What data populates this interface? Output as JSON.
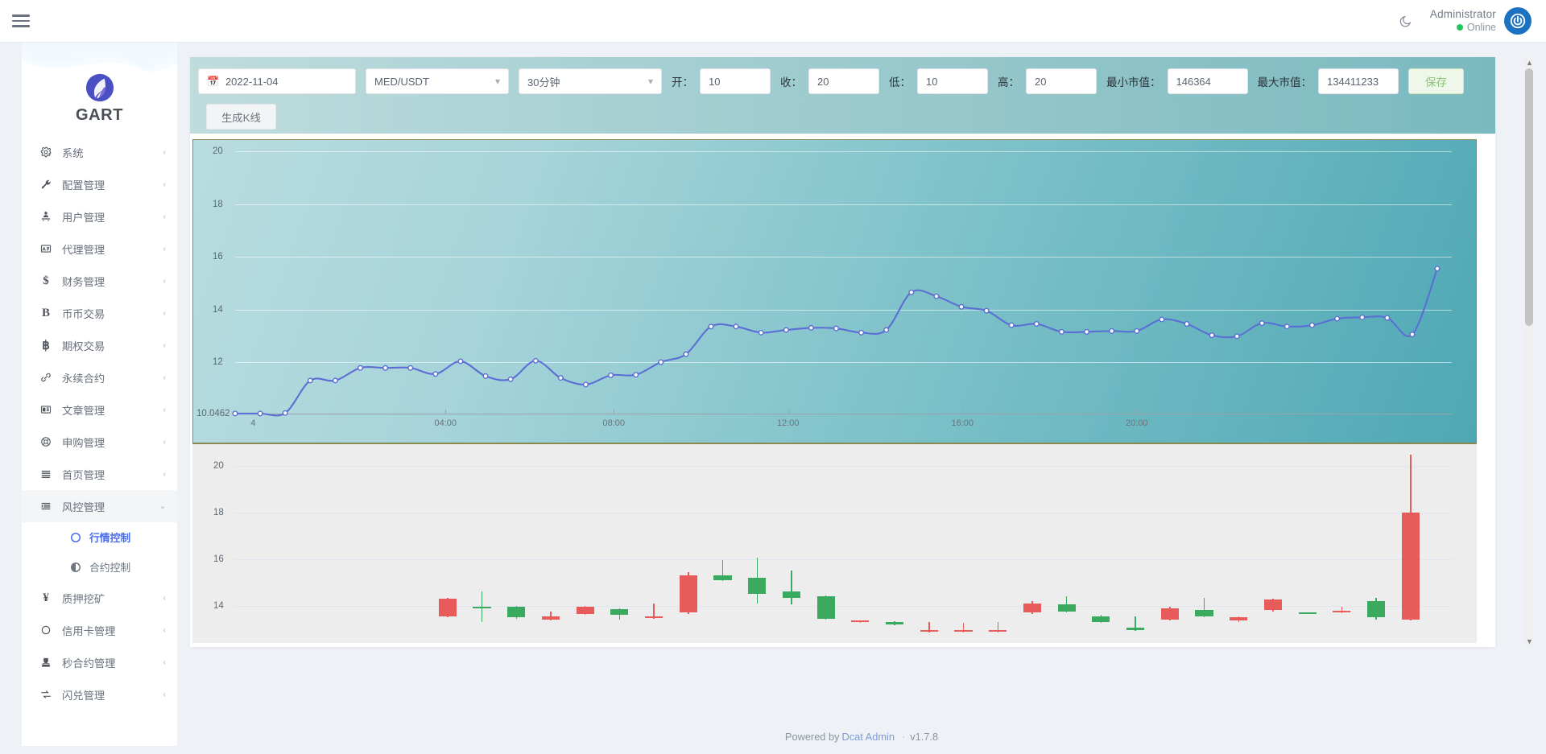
{
  "header": {
    "menu_icon": "hamburger-icon",
    "dark_mode_icon": "moon-icon",
    "user_name": "Administrator",
    "user_status": "Online",
    "avatar_icon": "power-avatar-icon"
  },
  "sidebar": {
    "brand": "GART",
    "items": [
      {
        "label": "系统",
        "icon": "gear-icon",
        "caret": "‹",
        "active": false
      },
      {
        "label": "配置管理",
        "icon": "wrench-icon",
        "caret": "‹",
        "active": false
      },
      {
        "label": "用户管理",
        "icon": "users-icon",
        "caret": "‹",
        "active": false
      },
      {
        "label": "代理管理",
        "icon": "id-card-icon",
        "caret": "‹",
        "active": false
      },
      {
        "label": "财务管理",
        "icon": "dollar-icon",
        "caret": "‹",
        "active": false
      },
      {
        "label": "币币交易",
        "icon": "letter-b-icon",
        "caret": "‹",
        "active": false
      },
      {
        "label": "期权交易",
        "icon": "bitcoin-icon",
        "caret": "‹",
        "active": false
      },
      {
        "label": "永续合约",
        "icon": "link-icon",
        "caret": "‹",
        "active": false
      },
      {
        "label": "文章管理",
        "icon": "newspaper-icon",
        "caret": "‹",
        "active": false
      },
      {
        "label": "申购管理",
        "icon": "lifering-icon",
        "caret": "‹",
        "active": false
      },
      {
        "label": "首页管理",
        "icon": "bars-icon",
        "caret": "‹",
        "active": false
      },
      {
        "label": "风控管理",
        "icon": "indent-icon",
        "caret": "⌄",
        "active": true
      }
    ],
    "submenu": [
      {
        "label": "行情控制",
        "icon": "circle-o-icon",
        "selected": true
      },
      {
        "label": "合约控制",
        "icon": "adjust-icon",
        "selected": false
      }
    ],
    "items_after": [
      {
        "label": "质押挖矿",
        "icon": "yen-icon",
        "caret": "‹"
      },
      {
        "label": "信用卡管理",
        "icon": "circle-icon",
        "caret": "‹"
      },
      {
        "label": "秒合约管理",
        "icon": "stamp-icon",
        "caret": "‹"
      },
      {
        "label": "闪兑管理",
        "icon": "exchange-icon",
        "caret": "‹"
      }
    ]
  },
  "toolbar": {
    "date_icon": "calendar-icon",
    "date_value": "2022-11-04",
    "pair_value": "MED/USDT",
    "pair_caret": "chevron-down-icon",
    "interval_value": "30分钟",
    "interval_caret": "chevron-down-icon",
    "open_label": "开：",
    "open_value": "10",
    "close_label": "收：",
    "close_value": "20",
    "low_label": "低：",
    "low_value": "10",
    "high_label": "高：",
    "high_value": "20",
    "min_cap_label": "最小市值：",
    "min_cap_value": "146364",
    "max_cap_label": "最大市值：",
    "max_cap_value": "134411233",
    "save_label": "保存",
    "generate_label": "生成K线"
  },
  "footer": {
    "powered_by": "Powered by",
    "link": "Dcat Admin",
    "separator": "·",
    "version": "v1.7.8"
  },
  "chart_data": [
    {
      "type": "line",
      "title": "",
      "xlabel": "",
      "ylabel": "",
      "ylim": [
        10.0462,
        20
      ],
      "yticks": [
        20,
        18,
        16,
        14,
        12,
        10.0462
      ],
      "ytick_labels": [
        "20",
        "18",
        "16",
        "14",
        "12",
        "10.0462"
      ],
      "xticks": [
        "4",
        "04:00",
        "08:00",
        "12:00",
        "16:00",
        "20:00"
      ],
      "xtick_positions_pct": [
        1.5,
        17.5,
        31.5,
        46.0,
        60.5,
        75.0
      ],
      "grid": true,
      "legend": "none",
      "line_color": "#5b6ed4",
      "marker_color": "#ffffff",
      "x": [
        0,
        1,
        2,
        3,
        4,
        5,
        6,
        7,
        8,
        9,
        10,
        11,
        12,
        13,
        14,
        15,
        16,
        17,
        18,
        19,
        20,
        21,
        22,
        23,
        24,
        25,
        26,
        27,
        28,
        29,
        30,
        31,
        32,
        33,
        34,
        35,
        36,
        37,
        38,
        39,
        40,
        41,
        42,
        43,
        44,
        45,
        46,
        47,
        48
      ],
      "values": [
        10.05,
        10.05,
        10.07,
        11.3,
        11.3,
        11.78,
        11.78,
        11.78,
        11.55,
        12.03,
        11.47,
        11.35,
        12.05,
        11.4,
        11.15,
        11.5,
        11.52,
        12.0,
        12.3,
        13.35,
        13.35,
        13.12,
        13.22,
        13.3,
        13.28,
        13.12,
        13.22,
        14.65,
        14.5,
        14.1,
        13.95,
        13.4,
        13.45,
        13.15,
        13.15,
        13.18,
        13.18,
        13.62,
        13.45,
        13.02,
        12.98,
        13.48,
        13.35,
        13.4,
        13.65,
        13.7,
        13.68,
        13.05,
        15.55
      ]
    },
    {
      "type": "candlestick",
      "title": "",
      "ylim": [
        12.5,
        20.6
      ],
      "yticks": [
        20,
        18,
        16,
        14
      ],
      "ytick_labels": [
        "20",
        "18",
        "16",
        "14"
      ],
      "grid": true,
      "up_color": "#3aab5e",
      "down_color": "#e85b5b",
      "candles": [
        {
          "o": 14.3,
          "c": 13.55,
          "h": 14.35,
          "l": 13.5,
          "dir": "down"
        },
        {
          "o": 13.95,
          "c": 13.95,
          "h": 14.6,
          "l": 13.3,
          "dir": "up"
        },
        {
          "o": 13.5,
          "c": 13.95,
          "h": 13.98,
          "l": 13.45,
          "dir": "up"
        },
        {
          "o": 13.55,
          "c": 13.4,
          "h": 13.75,
          "l": 13.38,
          "dir": "down"
        },
        {
          "o": 13.65,
          "c": 13.95,
          "h": 14.0,
          "l": 13.6,
          "dir": "down"
        },
        {
          "o": 13.85,
          "c": 13.6,
          "h": 13.9,
          "l": 13.4,
          "dir": "up"
        },
        {
          "o": 13.55,
          "c": 13.48,
          "h": 14.1,
          "l": 13.45,
          "dir": "down"
        },
        {
          "o": 15.3,
          "c": 13.7,
          "h": 15.45,
          "l": 13.65,
          "dir": "down"
        },
        {
          "o": 15.3,
          "c": 15.1,
          "h": 15.95,
          "l": 15.05,
          "dir": "up"
        },
        {
          "o": 15.2,
          "c": 14.5,
          "h": 16.05,
          "l": 14.1,
          "dir": "up"
        },
        {
          "o": 14.6,
          "c": 14.35,
          "h": 15.5,
          "l": 14.05,
          "dir": "up"
        },
        {
          "o": 14.4,
          "c": 13.45,
          "h": 14.45,
          "l": 13.4,
          "dir": "up"
        },
        {
          "o": 13.35,
          "c": 13.3,
          "h": 13.38,
          "l": 13.25,
          "dir": "down"
        },
        {
          "o": 13.3,
          "c": 13.2,
          "h": 13.32,
          "l": 13.15,
          "dir": "up"
        },
        {
          "o": 12.95,
          "c": 12.9,
          "h": 13.3,
          "l": 12.85,
          "dir": "down"
        },
        {
          "o": 12.95,
          "c": 12.9,
          "h": 13.25,
          "l": 12.85,
          "dir": "down"
        },
        {
          "o": 12.95,
          "c": 12.9,
          "h": 13.3,
          "l": 12.85,
          "dir": "down"
        },
        {
          "o": 14.1,
          "c": 13.7,
          "h": 14.18,
          "l": 13.65,
          "dir": "down"
        },
        {
          "o": 14.05,
          "c": 13.75,
          "h": 14.4,
          "l": 13.7,
          "dir": "up"
        },
        {
          "o": 13.55,
          "c": 13.3,
          "h": 13.6,
          "l": 13.25,
          "dir": "up"
        },
        {
          "o": 13.05,
          "c": 12.95,
          "h": 13.55,
          "l": 12.9,
          "dir": "up"
        },
        {
          "o": 13.9,
          "c": 13.4,
          "h": 13.95,
          "l": 13.35,
          "dir": "down"
        },
        {
          "o": 13.8,
          "c": 13.55,
          "h": 14.35,
          "l": 13.5,
          "dir": "up"
        },
        {
          "o": 13.5,
          "c": 13.35,
          "h": 13.55,
          "l": 13.3,
          "dir": "down"
        },
        {
          "o": 14.25,
          "c": 13.8,
          "h": 14.3,
          "l": 13.75,
          "dir": "down"
        },
        {
          "o": 13.7,
          "c": 13.68,
          "h": 13.72,
          "l": 13.66,
          "dir": "up"
        },
        {
          "o": 13.78,
          "c": 13.72,
          "h": 13.95,
          "l": 13.68,
          "dir": "down"
        },
        {
          "o": 14.2,
          "c": 13.5,
          "h": 14.35,
          "l": 13.4,
          "dir": "up"
        },
        {
          "o": 18.0,
          "c": 13.4,
          "h": 20.5,
          "l": 13.35,
          "dir": "down"
        }
      ]
    }
  ]
}
